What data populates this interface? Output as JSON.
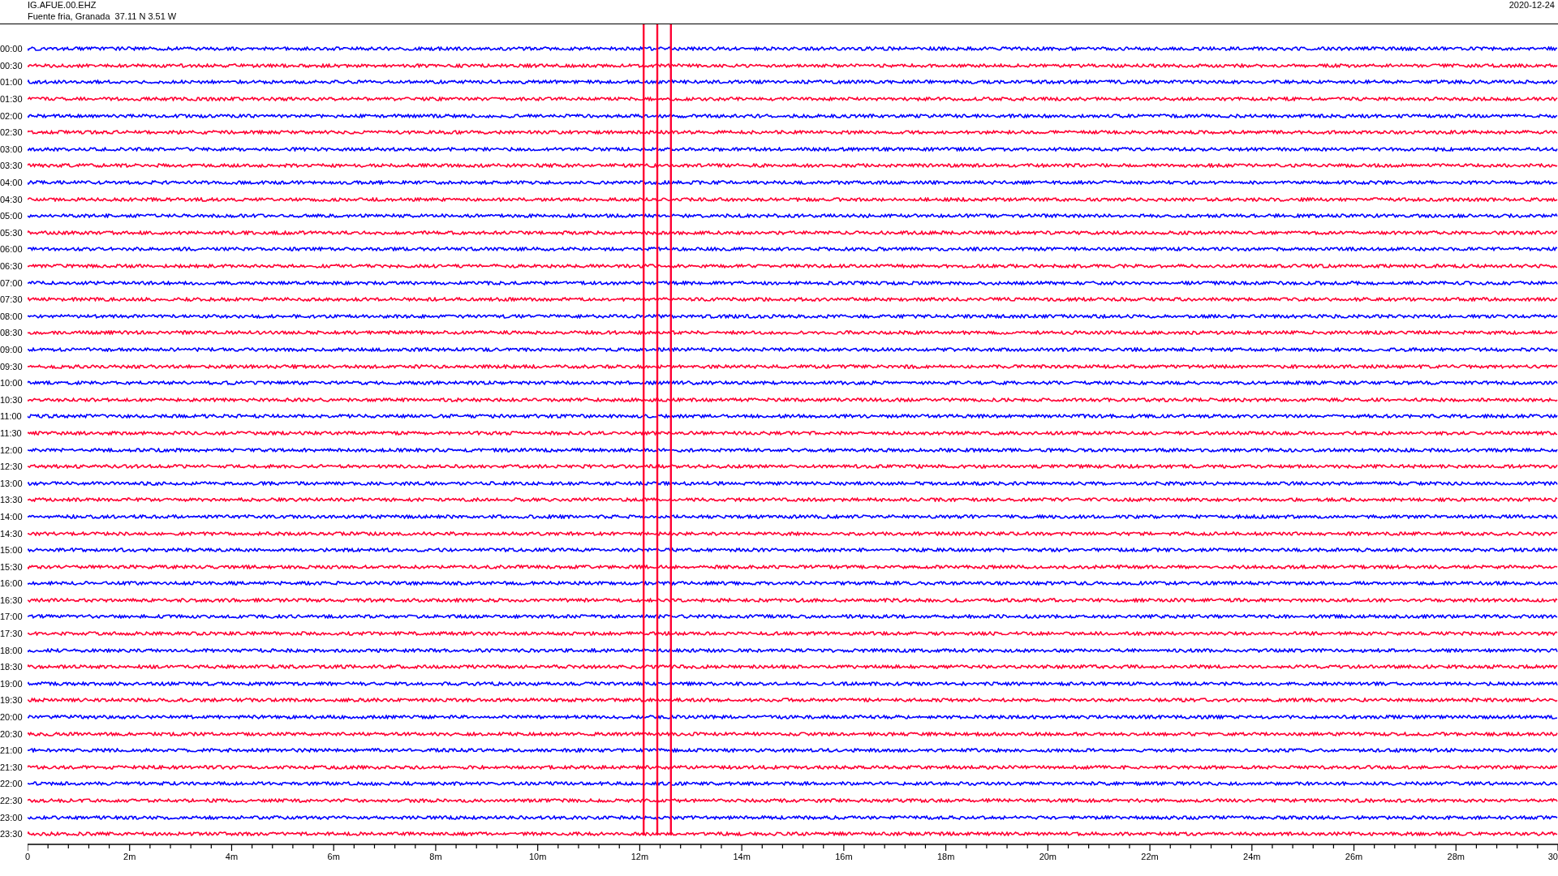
{
  "header": {
    "station": "IG.AFUE.00.EHZ",
    "location": "Fuente fria, Granada  37.11 N 3.51 W",
    "date": "2020-12-24"
  },
  "rows": [
    {
      "time": "00:00",
      "color": "#0000ff"
    },
    {
      "time": "00:30",
      "color": "#ff0033"
    },
    {
      "time": "01:00",
      "color": "#0000ff"
    },
    {
      "time": "01:30",
      "color": "#ff0033"
    },
    {
      "time": "02:00",
      "color": "#0000ff"
    },
    {
      "time": "02:30",
      "color": "#ff0033"
    },
    {
      "time": "03:00",
      "color": "#0000ff"
    },
    {
      "time": "03:30",
      "color": "#ff0033"
    },
    {
      "time": "04:00",
      "color": "#0000ff"
    },
    {
      "time": "04:30",
      "color": "#ff0033"
    },
    {
      "time": "05:00",
      "color": "#0000ff"
    },
    {
      "time": "05:30",
      "color": "#ff0033"
    },
    {
      "time": "06:00",
      "color": "#0000ff"
    },
    {
      "time": "06:30",
      "color": "#ff0033"
    },
    {
      "time": "07:00",
      "color": "#0000ff"
    },
    {
      "time": "07:30",
      "color": "#ff0033"
    },
    {
      "time": "08:00",
      "color": "#0000ff"
    },
    {
      "time": "08:30",
      "color": "#ff0033"
    },
    {
      "time": "09:00",
      "color": "#0000ff"
    },
    {
      "time": "09:30",
      "color": "#ff0033"
    },
    {
      "time": "10:00",
      "color": "#0000ff"
    },
    {
      "time": "10:30",
      "color": "#ff0033"
    },
    {
      "time": "11:00",
      "color": "#0000ff"
    },
    {
      "time": "11:30",
      "color": "#ff0033"
    },
    {
      "time": "12:00",
      "color": "#0000ff"
    },
    {
      "time": "12:30",
      "color": "#ff0033"
    },
    {
      "time": "13:00",
      "color": "#0000ff"
    },
    {
      "time": "13:30",
      "color": "#ff0033"
    },
    {
      "time": "14:00",
      "color": "#0000ff"
    },
    {
      "time": "14:30",
      "color": "#ff0033"
    },
    {
      "time": "15:00",
      "color": "#0000ff"
    },
    {
      "time": "15:30",
      "color": "#ff0033"
    },
    {
      "time": "16:00",
      "color": "#0000ff"
    },
    {
      "time": "16:30",
      "color": "#ff0033"
    },
    {
      "time": "17:00",
      "color": "#0000ff"
    },
    {
      "time": "17:30",
      "color": "#ff0033"
    },
    {
      "time": "18:00",
      "color": "#0000ff"
    },
    {
      "time": "18:30",
      "color": "#ff0033"
    },
    {
      "time": "19:00",
      "color": "#0000ff"
    },
    {
      "time": "19:30",
      "color": "#ff0033"
    },
    {
      "time": "20:00",
      "color": "#0000ff"
    },
    {
      "time": "20:30",
      "color": "#ff0033"
    },
    {
      "time": "21:00",
      "color": "#0000ff"
    },
    {
      "time": "21:30",
      "color": "#ff0033"
    },
    {
      "time": "22:00",
      "color": "#0000ff"
    },
    {
      "time": "22:30",
      "color": "#ff0033"
    },
    {
      "time": "23:00",
      "color": "#0000ff"
    },
    {
      "time": "23:30",
      "color": "#ff0033"
    }
  ],
  "x_axis": {
    "labels": [
      "0",
      "2m",
      "4m",
      "6m",
      "8m",
      "10m",
      "12m",
      "14m",
      "16m",
      "18m",
      "20m",
      "22m",
      "24m",
      "26m",
      "28m",
      "30"
    ]
  }
}
